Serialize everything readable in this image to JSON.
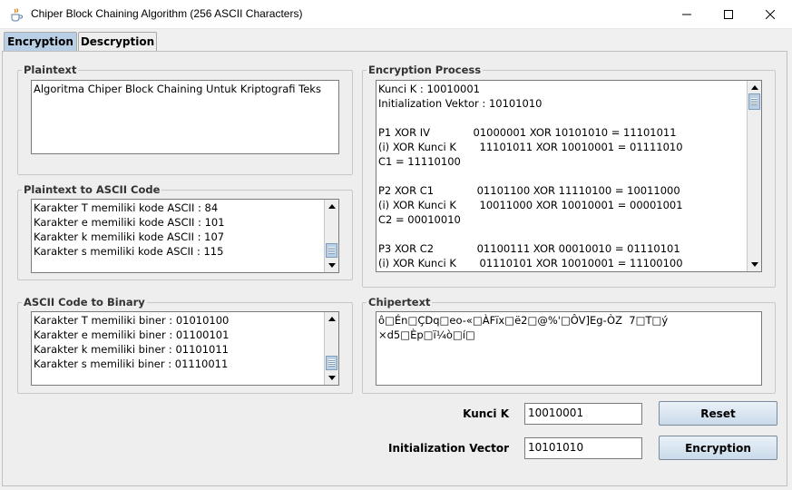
{
  "window": {
    "title": "Chiper Block Chaining Algorithm (256 ASCII Characters)"
  },
  "tabs": [
    {
      "label": "Encryption",
      "active": true
    },
    {
      "label": "Descryption",
      "active": false
    }
  ],
  "plaintext": {
    "title": "Plaintext",
    "value": "Algoritma Chiper Block Chaining Untuk Kriptografi Teks"
  },
  "ascii_code": {
    "title": "Plaintext to ASCII Code",
    "lines": [
      "Karakter T memiliki kode ASCII : 84",
      "Karakter e memiliki kode ASCII : 101",
      "Karakter k memiliki kode ASCII : 107",
      "Karakter s memiliki kode ASCII : 115"
    ]
  },
  "binary": {
    "title": "ASCII Code to Binary",
    "lines": [
      "Karakter T memiliki biner : 01010100",
      "Karakter e memiliki biner : 01100101",
      "Karakter k memiliki biner : 01101011",
      "Karakter s memiliki biner : 01110011"
    ]
  },
  "process": {
    "title": "Encryption Process",
    "lines": [
      "Kunci K : 10010001",
      "Initialization Vektor : 10101010",
      "",
      "P1 XOR IV             01000001 XOR 10101010 = 11101011",
      "(i) XOR Kunci K       11101011 XOR 10010001 = 01111010",
      "C1 = 11110100",
      "",
      "P2 XOR C1             01101100 XOR 11110100 = 10011000",
      "(i) XOR Kunci K       10011000 XOR 10010001 = 00001001",
      "C2 = 00010010",
      "",
      "P3 XOR C2             01100111 XOR 00010010 = 01110101",
      "(i) XOR Kunci K       01110101 XOR 10010001 = 11100100"
    ]
  },
  "chipertext": {
    "title": "Chipertext",
    "lines": [
      "ô□Én□ÇDq□eo-«□ÀFïx□ë2□@%'□ÔV]Eg-ÒZ  7□T□ý",
      "×d5□Èp□ï¼ò□í□"
    ]
  },
  "form": {
    "key_label": "Kunci K",
    "key_value": "10010001",
    "iv_label": "Initialization Vector",
    "iv_value": "10101010",
    "reset_label": "Reset",
    "encrypt_label": "Encryption"
  },
  "colors": {
    "tab_active": "#b8cfe5",
    "button_top": "#eaf1f8",
    "button_bottom": "#c9daea"
  }
}
